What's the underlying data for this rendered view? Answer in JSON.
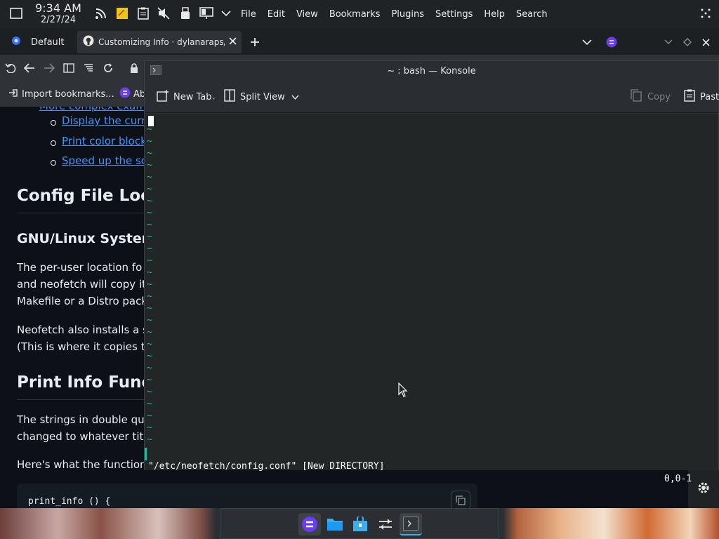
{
  "panel": {
    "time": "9:34 AM",
    "date": "2/27/24",
    "menu": [
      "File",
      "Edit",
      "View",
      "Bookmarks",
      "Plugins",
      "Settings",
      "Help",
      "Search"
    ]
  },
  "browser": {
    "tabs": [
      {
        "label": "Default",
        "icon": "firefox-profile-icon"
      },
      {
        "label": "Customizing Info · dylanaraps/n",
        "icon": "github-icon"
      }
    ],
    "bookmarks": [
      {
        "label": "Import bookmarks...",
        "icon": "import-icon"
      },
      {
        "label": "Ab",
        "icon": "app-icon"
      }
    ]
  },
  "page": {
    "top_link_fragment": "More complex exam",
    "bullets": [
      "Display the curr",
      "Print color block",
      "Speed up the sc"
    ],
    "h2_config": "Config File Loca",
    "h3_gnu": "GNU/Linux System",
    "para1": [
      "The per-user location fo",
      "and neofetch will copy it",
      "Makefile or a Distro pack"
    ],
    "para2": [
      "Neofetch also installs a s",
      "(This is where it copies th"
    ],
    "h2_print": "Print Info Funct",
    "para3": [
      "The strings in double qu",
      "changed to whatever titl"
    ],
    "para4": "Here's what the function",
    "code": "print_info () {"
  },
  "konsole": {
    "title": "~ : bash — Konsole",
    "toolbar": {
      "new_tab": "New Tab",
      "split_view": "Split View",
      "copy": "Copy",
      "paste": "Past"
    },
    "tilde": "~",
    "tilde_count": 27,
    "status_message": "\"/etc/neofetch/config.conf\" [New DIRECTORY]",
    "status_position": "0,0-1"
  },
  "colors": {
    "accent": "#1abc9c",
    "link": "#4493f8",
    "terminal_bg": "#232627",
    "page_bg": "#0d1117"
  }
}
